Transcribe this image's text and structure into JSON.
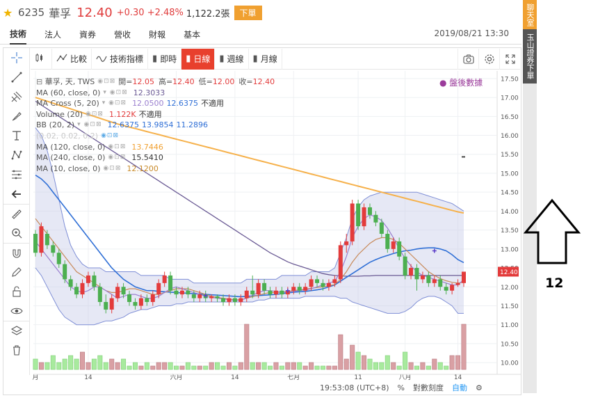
{
  "header": {
    "code": "6235",
    "name": "華孚",
    "price": "12.40",
    "change": "+0.30 +2.48%",
    "volume": "1,122.2張",
    "order_label": "下單"
  },
  "tabs": [
    {
      "label": "技術",
      "active": true
    },
    {
      "label": "法人",
      "active": false
    },
    {
      "label": "資券",
      "active": false
    },
    {
      "label": "營收",
      "active": false
    },
    {
      "label": "財報",
      "active": false
    },
    {
      "label": "基本",
      "active": false
    }
  ],
  "datetime": "2019/08/21 13:30",
  "rail": {
    "chat": "聊天室",
    "broker": "玉山證券下單"
  },
  "toolbar": {
    "compare": "比較",
    "indicators": "技術指標",
    "realtime": "即時",
    "daily": "日線",
    "weekly": "週線",
    "monthly": "月線"
  },
  "legend": {
    "symbol": "華孚, 天, TWS",
    "open_label": "開=",
    "open": "12.05",
    "high_label": "高=",
    "high": "12.40",
    "low_label": "低=",
    "low": "12.00",
    "close_label": "收=",
    "close": "12.40",
    "ma60": "MA (60, close, 0)",
    "ma60_v": "12.3033",
    "macross": "MA Cross (5, 20)",
    "macross_v1": "12.0500",
    "macross_v2": "12.6375",
    "macross_v3": "不適用",
    "volume": "Volume (20)",
    "volume_v1": "1.122K",
    "volume_v2": "不適用",
    "bb": "BB (20, 2)",
    "bb_v1": "12.6375",
    "bb_v2": "13.9854",
    "bb_v3": "11.2896",
    "sar": "(0.02, 0.02, 0.2)",
    "ma120": "MA (120, close, 0)",
    "ma120_v": "13.7446",
    "ma240": "MA (240, close, 0)",
    "ma240_v": "15.5410",
    "ma10": "MA (10, close, 0)",
    "ma10_v": "12.1200"
  },
  "after_hours": "盤後數據",
  "statusbar": {
    "time": "19:53:08 (UTC+8)",
    "percent": "%",
    "log": "對數刻度",
    "auto": "自動"
  },
  "annotation": {
    "number": "12"
  },
  "colors": {
    "up": "#e33b3b",
    "down": "#4caf50",
    "bb_fill": "#c7cbe8",
    "ma240": "#f6b14b",
    "ma60": "#6b5b95",
    "ma20": "#2f6fd6",
    "ma10": "#c88a5a",
    "ma5": "#9a7fcf"
  },
  "chart_data": {
    "type": "candlestick",
    "y_ticks": [
      "17.50",
      "17.00",
      "16.50",
      "16.00",
      "15.50",
      "15.00",
      "14.50",
      "14.00",
      "13.50",
      "13.00",
      "12.50",
      "12.00",
      "11.50",
      "11.00",
      "10.50",
      "10.00"
    ],
    "x_ticks": [
      "月",
      "14",
      "六月",
      "14",
      "七月",
      "11",
      "八月",
      "14"
    ],
    "last_price_label": "12.40",
    "ylim": [
      9.8,
      17.7
    ],
    "candles": [
      [
        13.4,
        12.9,
        13.5,
        12.8
      ],
      [
        12.9,
        13.6,
        13.7,
        12.8
      ],
      [
        13.4,
        13.1,
        13.5,
        13.0
      ],
      [
        13.1,
        12.9,
        13.2,
        12.8
      ],
      [
        12.9,
        12.6,
        13.0,
        12.5
      ],
      [
        12.6,
        12.2,
        12.7,
        12.1
      ],
      [
        12.2,
        12.0,
        12.3,
        11.9
      ],
      [
        12.0,
        11.8,
        12.1,
        11.7
      ],
      [
        11.8,
        12.1,
        12.2,
        11.7
      ],
      [
        12.1,
        12.3,
        12.4,
        12.0
      ],
      [
        12.3,
        12.0,
        12.4,
        11.9
      ],
      [
        12.0,
        11.6,
        12.1,
        11.5
      ],
      [
        11.6,
        11.4,
        11.8,
        11.3
      ],
      [
        11.4,
        11.7,
        11.8,
        11.3
      ],
      [
        11.7,
        12.0,
        12.1,
        11.6
      ],
      [
        12.0,
        11.8,
        12.1,
        11.7
      ],
      [
        11.8,
        11.6,
        11.9,
        11.5
      ],
      [
        11.6,
        11.5,
        11.7,
        11.4
      ],
      [
        11.5,
        11.7,
        11.8,
        11.4
      ],
      [
        11.7,
        11.6,
        11.8,
        11.5
      ],
      [
        11.6,
        11.8,
        11.9,
        11.5
      ],
      [
        11.8,
        12.1,
        12.2,
        11.7
      ],
      [
        12.1,
        12.3,
        12.4,
        12.0
      ],
      [
        12.3,
        11.9,
        12.4,
        11.8
      ],
      [
        11.9,
        11.8,
        12.0,
        11.7
      ],
      [
        11.8,
        11.9,
        12.0,
        11.7
      ],
      [
        11.9,
        11.8,
        12.0,
        11.7
      ],
      [
        11.8,
        11.7,
        11.9,
        11.6
      ],
      [
        11.7,
        11.8,
        11.9,
        11.6
      ],
      [
        11.8,
        11.7,
        11.9,
        11.6
      ],
      [
        11.7,
        11.75,
        11.8,
        11.6
      ],
      [
        11.75,
        11.7,
        11.8,
        11.6
      ],
      [
        11.7,
        11.6,
        11.8,
        11.5
      ],
      [
        11.6,
        11.7,
        11.8,
        11.5
      ],
      [
        11.7,
        11.6,
        11.8,
        11.5
      ],
      [
        11.6,
        11.7,
        11.8,
        11.5
      ],
      [
        11.7,
        11.9,
        12.0,
        11.6
      ],
      [
        11.9,
        11.8,
        12.3,
        11.7
      ],
      [
        11.8,
        12.1,
        12.2,
        11.7
      ],
      [
        12.1,
        11.9,
        12.2,
        11.8
      ],
      [
        11.9,
        11.8,
        12.0,
        11.7
      ],
      [
        11.8,
        11.9,
        12.0,
        11.7
      ],
      [
        11.9,
        11.8,
        12.0,
        11.7
      ],
      [
        11.8,
        11.9,
        12.0,
        11.7
      ],
      [
        11.9,
        12.0,
        12.1,
        11.8
      ],
      [
        12.0,
        11.9,
        12.1,
        11.8
      ],
      [
        11.9,
        12.0,
        12.1,
        11.8
      ],
      [
        12.0,
        12.2,
        12.3,
        11.9
      ],
      [
        12.2,
        12.1,
        12.3,
        12.0
      ],
      [
        12.1,
        12.0,
        12.2,
        11.9
      ],
      [
        12.0,
        12.1,
        12.2,
        11.9
      ],
      [
        12.1,
        12.2,
        12.3,
        12.0
      ],
      [
        12.2,
        13.1,
        13.2,
        12.1
      ],
      [
        13.1,
        13.2,
        13.4,
        12.9
      ],
      [
        13.2,
        14.2,
        14.3,
        13.1
      ],
      [
        14.2,
        13.6,
        14.3,
        13.5
      ],
      [
        13.6,
        14.1,
        14.2,
        13.5
      ],
      [
        14.1,
        13.9,
        14.2,
        13.8
      ],
      [
        13.9,
        13.7,
        14.0,
        13.6
      ],
      [
        13.7,
        13.4,
        13.8,
        13.3
      ],
      [
        13.4,
        13.0,
        13.5,
        12.9
      ],
      [
        13.0,
        13.2,
        13.3,
        12.9
      ],
      [
        13.2,
        12.8,
        13.3,
        12.7
      ],
      [
        12.8,
        12.3,
        12.9,
        12.2
      ],
      [
        12.3,
        12.5,
        12.6,
        12.2
      ],
      [
        12.5,
        12.2,
        12.6,
        11.9
      ],
      [
        12.2,
        12.3,
        12.4,
        12.1
      ],
      [
        12.3,
        12.1,
        12.4,
        12.0
      ],
      [
        12.1,
        12.2,
        12.3,
        12.0
      ],
      [
        12.2,
        12.0,
        12.3,
        11.9
      ],
      [
        12.0,
        11.9,
        12.1,
        11.8
      ],
      [
        11.9,
        12.05,
        12.1,
        11.8
      ],
      [
        12.05,
        12.1,
        12.2,
        12.0
      ],
      [
        12.1,
        12.4,
        12.4,
        12.0
      ]
    ],
    "volumes": [
      3,
      2,
      2,
      4,
      2,
      3,
      4,
      3,
      5,
      2,
      3,
      4,
      2,
      3,
      2,
      3,
      1,
      2,
      1,
      2,
      1,
      2,
      2,
      2,
      1,
      1,
      2,
      1,
      1,
      1,
      2,
      2,
      1,
      2,
      1,
      2,
      13,
      2,
      2,
      2,
      1,
      2,
      1,
      2,
      2,
      2,
      1,
      2,
      1,
      1,
      1,
      1,
      10,
      3,
      7,
      5,
      4,
      3,
      2,
      2,
      4,
      2,
      1,
      5,
      2,
      1,
      2,
      1,
      3,
      2,
      1,
      4,
      4,
      13
    ],
    "bb_upper": [
      16.2,
      16.0,
      15.6,
      15.0,
      14.3,
      13.6,
      13.1,
      12.8,
      12.6,
      12.5,
      12.5,
      12.5,
      12.4,
      12.4,
      12.4,
      12.4,
      12.4,
      12.4,
      12.3,
      12.3,
      12.3,
      12.3,
      12.3,
      12.2,
      12.2,
      12.2,
      12.2,
      12.1,
      12.1,
      12.1,
      12.1,
      12.1,
      12.1,
      12.1,
      12.1,
      12.1,
      12.2,
      12.2,
      12.2,
      12.2,
      12.2,
      12.2,
      12.3,
      12.3,
      12.3,
      12.3,
      12.3,
      12.4,
      12.4,
      12.4,
      12.4,
      12.5,
      12.9,
      13.3,
      13.8,
      14.1,
      14.3,
      14.4,
      14.45,
      14.5,
      14.5,
      14.5,
      14.5,
      14.5,
      14.5,
      14.5,
      14.45,
      14.4,
      14.35,
      14.3,
      14.25,
      14.2,
      14.1,
      14.0
    ],
    "bb_lower": [
      12.5,
      12.3,
      12.0,
      11.7,
      11.4,
      11.2,
      11.1,
      11.0,
      11.0,
      11.0,
      11.0,
      11.05,
      11.1,
      11.1,
      11.15,
      11.2,
      11.3,
      11.35,
      11.4,
      11.4,
      11.45,
      11.5,
      11.5,
      11.5,
      11.55,
      11.55,
      11.6,
      11.6,
      11.6,
      11.6,
      11.6,
      11.6,
      11.6,
      11.6,
      11.6,
      11.6,
      11.6,
      11.6,
      11.65,
      11.65,
      11.7,
      11.7,
      11.7,
      11.7,
      11.7,
      11.7,
      11.75,
      11.75,
      11.75,
      11.75,
      11.75,
      11.75,
      11.7,
      11.7,
      11.6,
      11.55,
      11.5,
      11.45,
      11.4,
      11.35,
      11.3,
      11.3,
      11.3,
      11.35,
      11.45,
      11.6,
      11.7,
      11.75,
      11.75,
      11.7,
      11.6,
      11.5,
      11.3,
      11.3
    ],
    "ma20": [
      14.95,
      14.85,
      14.7,
      14.5,
      14.3,
      14.1,
      13.9,
      13.7,
      13.5,
      13.3,
      13.1,
      12.9,
      12.7,
      12.5,
      12.35,
      12.2,
      12.1,
      12.0,
      11.95,
      11.9,
      11.9,
      11.88,
      11.87,
      11.86,
      11.85,
      11.84,
      11.83,
      11.82,
      11.81,
      11.8,
      11.79,
      11.78,
      11.77,
      11.76,
      11.75,
      11.74,
      11.75,
      11.76,
      11.77,
      11.78,
      11.79,
      11.8,
      11.82,
      11.84,
      11.86,
      11.87,
      11.88,
      11.9,
      11.92,
      11.95,
      12.0,
      12.05,
      12.15,
      12.25,
      12.35,
      12.45,
      12.55,
      12.65,
      12.72,
      12.78,
      12.83,
      12.88,
      12.92,
      12.95,
      12.97,
      13.0,
      13.02,
      13.03,
      13.03,
      13.0,
      12.95,
      12.85,
      12.72,
      12.64
    ],
    "ma60": [
      16.9,
      16.8,
      16.7,
      16.6,
      16.5,
      16.4,
      16.3,
      16.2,
      16.1,
      16.0,
      15.9,
      15.8,
      15.7,
      15.6,
      15.5,
      15.4,
      15.3,
      15.2,
      15.1,
      15.0,
      14.9,
      14.8,
      14.7,
      14.6,
      14.5,
      14.4,
      14.3,
      14.2,
      14.1,
      14.0,
      13.9,
      13.8,
      13.7,
      13.6,
      13.5,
      13.4,
      13.3,
      13.2,
      13.1,
      13.0,
      12.9,
      12.82,
      12.74,
      12.66,
      12.6,
      12.55,
      12.5,
      12.45,
      12.4,
      12.35,
      12.32,
      12.3,
      12.29,
      12.28,
      12.28,
      12.28,
      12.29,
      12.29,
      12.3,
      12.3,
      12.3,
      12.3,
      12.3,
      12.3,
      12.3,
      12.3,
      12.3,
      12.3,
      12.3,
      12.3,
      12.3,
      12.3,
      12.3,
      12.3
    ],
    "ma240": [
      17.0,
      16.95,
      16.9,
      16.85,
      16.8,
      16.75,
      16.7,
      16.65,
      16.6,
      16.55,
      16.5,
      16.45,
      16.4,
      16.35,
      16.3,
      16.26,
      16.22,
      16.18,
      16.14,
      16.1,
      16.06,
      16.02,
      15.98,
      15.94,
      15.9,
      15.86,
      15.82,
      15.78,
      15.74,
      15.7,
      15.66,
      15.62,
      15.58,
      15.54,
      15.5,
      15.46,
      15.42,
      15.38,
      15.34,
      15.3,
      15.26,
      15.22,
      15.18,
      15.14,
      15.1,
      15.06,
      15.02,
      14.98,
      14.94,
      14.9,
      14.86,
      14.82,
      14.78,
      14.74,
      14.7,
      14.66,
      14.62,
      14.58,
      14.54,
      14.5,
      14.46,
      14.42,
      14.38,
      14.34,
      14.3,
      14.26,
      14.22,
      14.18,
      14.14,
      14.1,
      14.06,
      14.02,
      13.98,
      13.95
    ],
    "ma10": [
      13.8,
      13.6,
      13.4,
      13.2,
      13.0,
      12.8,
      12.6,
      12.4,
      12.3,
      12.2,
      12.1,
      12.0,
      11.9,
      11.85,
      11.85,
      11.9,
      11.95,
      11.95,
      11.9,
      11.85,
      11.8,
      11.8,
      11.85,
      11.9,
      11.95,
      11.95,
      11.95,
      11.9,
      11.85,
      11.8,
      11.75,
      11.72,
      11.7,
      11.68,
      11.66,
      11.66,
      11.7,
      11.74,
      11.78,
      11.82,
      11.85,
      11.85,
      11.86,
      11.88,
      11.9,
      11.92,
      11.94,
      11.96,
      11.98,
      12.0,
      12.03,
      12.06,
      12.2,
      12.4,
      12.65,
      12.85,
      13.0,
      13.15,
      13.25,
      13.3,
      13.3,
      13.25,
      13.15,
      13.0,
      12.85,
      12.7,
      12.55,
      12.4,
      12.3,
      12.22,
      12.16,
      12.12,
      12.1,
      12.12
    ],
    "ma5": [
      13.2,
      13.0,
      12.8,
      12.6,
      12.4,
      12.2,
      12.0,
      11.9,
      11.85,
      11.9,
      12.0,
      12.0,
      11.9,
      11.8,
      11.7,
      11.75,
      11.8,
      11.8,
      11.75,
      11.7,
      11.7,
      11.75,
      11.85,
      11.95,
      12.0,
      11.95,
      11.9,
      11.85,
      11.8,
      11.75,
      11.72,
      11.7,
      11.68,
      11.66,
      11.64,
      11.65,
      11.7,
      11.78,
      11.85,
      11.9,
      11.9,
      11.88,
      11.86,
      11.86,
      11.88,
      11.9,
      11.92,
      11.95,
      12.0,
      12.05,
      12.1,
      12.15,
      12.4,
      12.8,
      13.3,
      13.6,
      13.8,
      13.9,
      13.85,
      13.75,
      13.55,
      13.3,
      13.0,
      12.75,
      12.55,
      12.4,
      12.3,
      12.25,
      12.2,
      12.15,
      12.1,
      12.05,
      12.05,
      12.2
    ]
  }
}
